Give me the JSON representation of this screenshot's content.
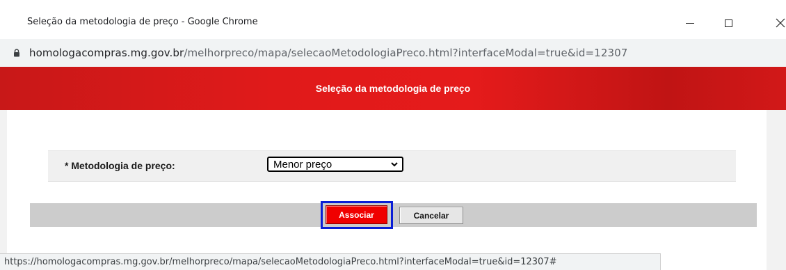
{
  "window": {
    "title": "Seleção da metodologia de preço - Google Chrome",
    "controls": {
      "minimize": "—",
      "close": "✕"
    }
  },
  "address_bar": {
    "host": "homologacompras.mg.gov.br",
    "path": "/melhorpreco/mapa/selecaoMetodologiaPreco.html?interfaceModal=true&id=12307"
  },
  "dialog": {
    "title": "Seleção da metodologia de preço",
    "field_label": "* Metodologia de preço:",
    "select_value": "Menor preço",
    "associate_label": "Associar",
    "cancel_label": "Cancelar"
  },
  "status_bar": {
    "url": "https://homologacompras.mg.gov.br/melhorpreco/mapa/selecaoMetodologiaPreco.html?interfaceModal=true&id=12307#"
  },
  "colors": {
    "header_red": "#e01a1a",
    "associate_red": "#f00000",
    "focus_blue": "#0a1ed6"
  }
}
